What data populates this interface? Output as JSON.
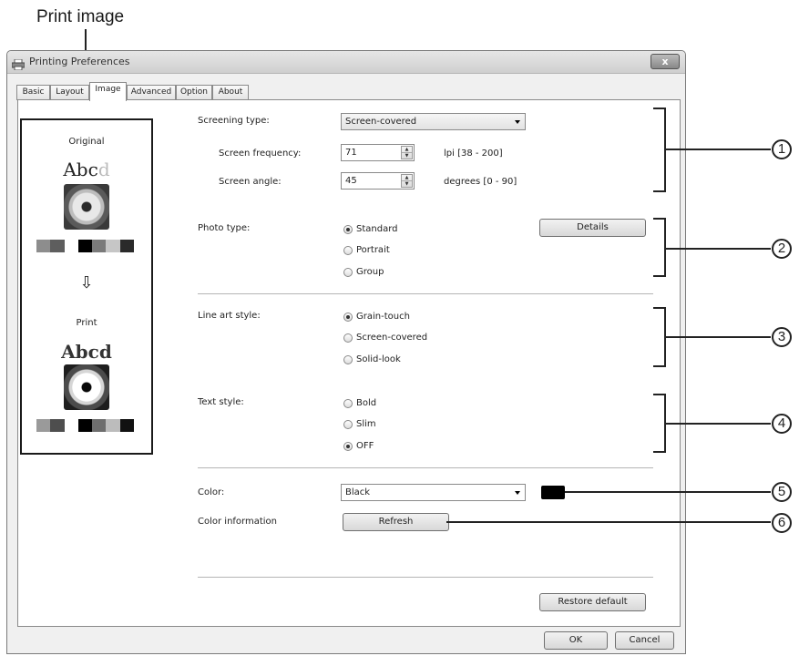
{
  "callout": {
    "print_image": "Print image"
  },
  "window": {
    "title": "Printing Preferences",
    "close": "x"
  },
  "tabs": [
    {
      "label": "Basic"
    },
    {
      "label": "Layout"
    },
    {
      "label": "Image"
    },
    {
      "label": "Advanced"
    },
    {
      "label": "Option"
    },
    {
      "label": "About"
    }
  ],
  "preview": {
    "original_label": "Original",
    "original_text": "Abc",
    "original_text_faded": "d",
    "arrow": "⇩",
    "print_label": "Print",
    "print_text": "Abcd",
    "original_swatches": [
      "#8d8d8d",
      "#5e5e5e",
      "#ffffff",
      "#000000",
      "#7a7a7a",
      "#c6c6c6",
      "#2a2a2a"
    ],
    "print_swatches": [
      "#9a9a9a",
      "#4e4e4e",
      "#ffffff",
      "#000000",
      "#6e6e6e",
      "#bcbcbc",
      "#111111"
    ]
  },
  "screening": {
    "label": "Screening type:",
    "value": "Screen-covered",
    "freq_label": "Screen frequency:",
    "freq_value": "71",
    "freq_unit": "lpi [38 - 200]",
    "angle_label": "Screen angle:",
    "angle_value": "45",
    "angle_unit": "degrees [0 - 90]"
  },
  "photo": {
    "label": "Photo type:",
    "options": [
      "Standard",
      "Portrait",
      "Group"
    ],
    "details": "Details"
  },
  "lineart": {
    "label": "Line art style:",
    "options": [
      "Grain-touch",
      "Screen-covered",
      "Solid-look"
    ]
  },
  "text": {
    "label": "Text style:",
    "options": [
      "Bold",
      "Slim",
      "OFF"
    ]
  },
  "color": {
    "label": "Color:",
    "value": "Black",
    "swatch": "#000000",
    "info_label": "Color information",
    "refresh": "Refresh"
  },
  "footer": {
    "restore": "Restore default",
    "ok": "OK",
    "cancel": "Cancel"
  },
  "callouts": [
    "1",
    "2",
    "3",
    "4",
    "5",
    "6"
  ]
}
